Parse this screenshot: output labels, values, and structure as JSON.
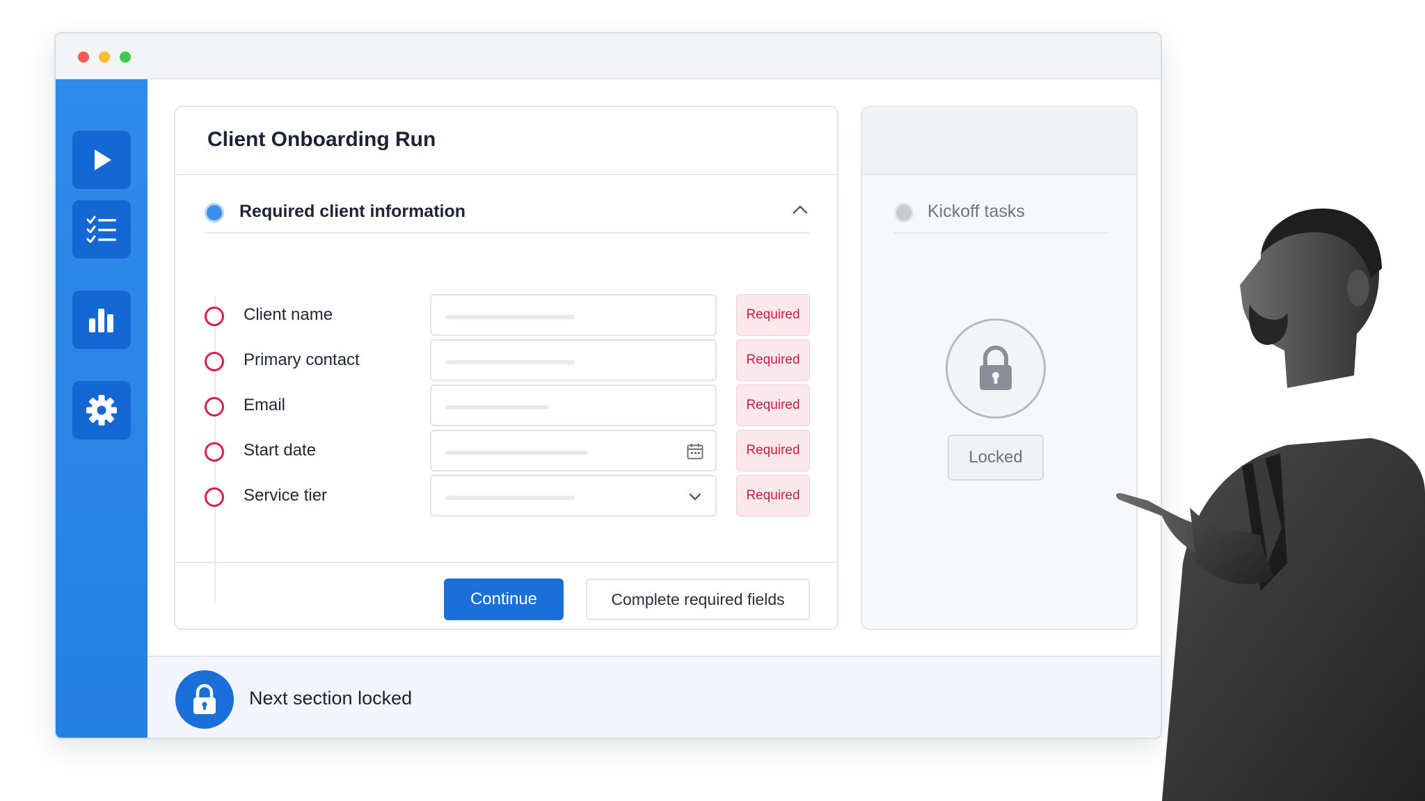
{
  "window": {
    "traffic_lights": [
      "close",
      "minimize",
      "maximize"
    ]
  },
  "sidebar": {
    "items": [
      {
        "icon": "play-icon"
      },
      {
        "icon": "checklist-icon"
      },
      {
        "icon": "bar-chart-icon"
      },
      {
        "icon": "gear-icon"
      }
    ]
  },
  "main": {
    "title": "Client Onboarding Run",
    "section_title": "Required client information",
    "fields": [
      {
        "label": "Client name",
        "badge": "Required",
        "placeholder_fill": 0.5
      },
      {
        "label": "Primary contact",
        "badge": "Required",
        "placeholder_fill": 0.5
      },
      {
        "label": "Email",
        "badge": "Required",
        "placeholder_fill": 0.4
      },
      {
        "label": "Start date",
        "badge": "Required",
        "placeholder_fill": 0.55,
        "icon": "calendar-icon"
      },
      {
        "label": "Service tier",
        "badge": "Required",
        "placeholder_fill": 0.5,
        "icon": "chevron-down-icon"
      }
    ],
    "continue_label": "Continue",
    "complete_label": "Complete required fields"
  },
  "side_panel": {
    "section_title": "Kickoff tasks",
    "locked_label": "Locked"
  },
  "bottom_bar": {
    "text": "Next section locked"
  },
  "colors": {
    "sidebar": "#2f8bea",
    "sidebar_button": "#1567d3",
    "primary": "#1a6fd9",
    "required": "#c41c45",
    "required_bg": "#fce8ec"
  }
}
